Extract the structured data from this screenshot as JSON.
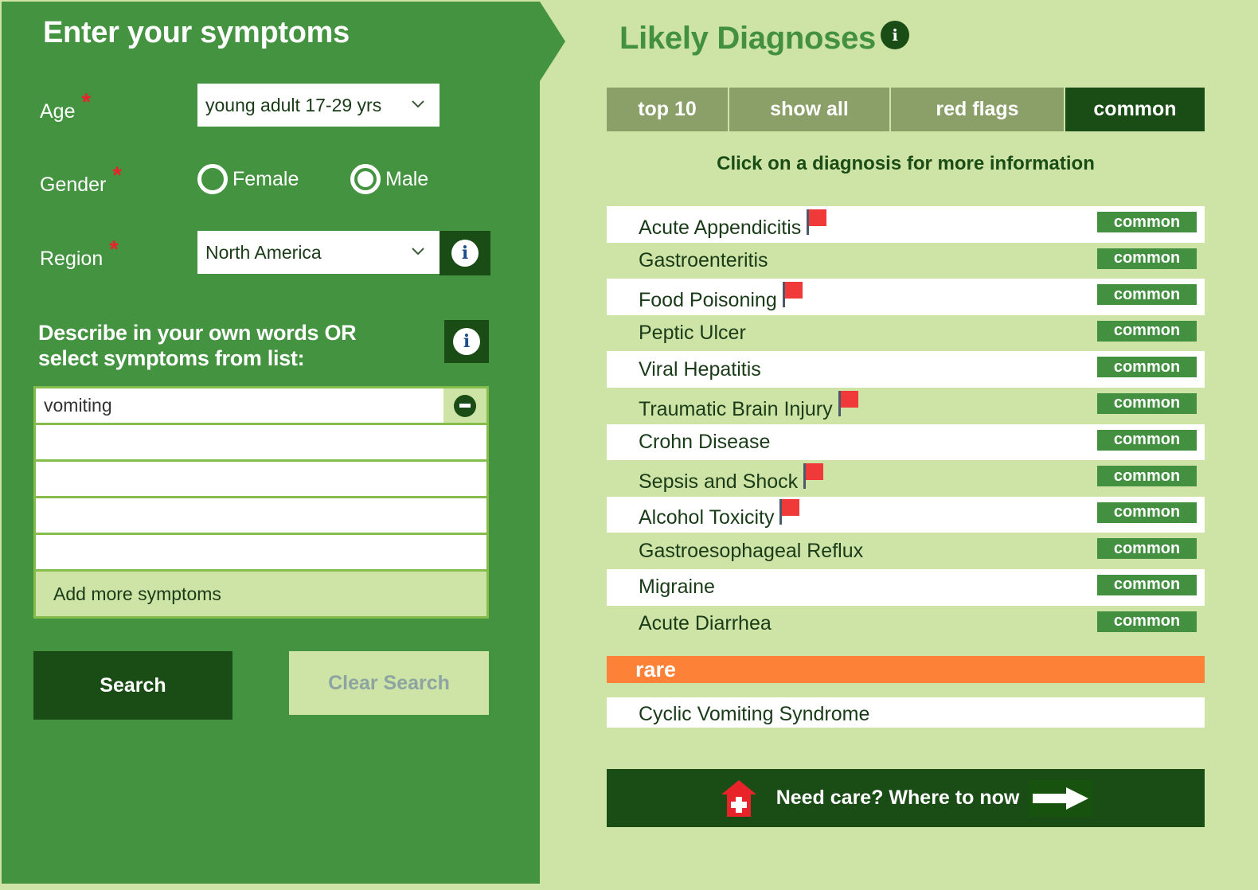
{
  "left": {
    "title": "Enter your symptoms",
    "age": {
      "label": "Age",
      "required_mark": "*",
      "value": "young adult 17-29 yrs"
    },
    "gender": {
      "label": "Gender",
      "required_mark": "*",
      "options": [
        {
          "label": "Female",
          "selected": false
        },
        {
          "label": "Male",
          "selected": true
        }
      ]
    },
    "region": {
      "label": "Region",
      "required_mark": "*",
      "value": "North America",
      "info_glyph": "i"
    },
    "describe": {
      "line1": "Describe in your own words OR",
      "line2": "select symptoms from list:",
      "info_glyph": "i"
    },
    "symptoms": [
      "vomiting",
      "",
      "",
      "",
      ""
    ],
    "add_more_label": "Add more symptoms",
    "search_label": "Search",
    "clear_label": "Clear Search"
  },
  "right": {
    "title": "Likely Diagnoses",
    "title_info_glyph": "i",
    "tabs": [
      {
        "label": "top 10",
        "active": false
      },
      {
        "label": "show all",
        "active": false
      },
      {
        "label": "red flags",
        "active": false
      },
      {
        "label": "common",
        "active": true
      }
    ],
    "hint": "Click on a diagnosis for more information",
    "diagnoses": [
      {
        "name": "Acute Appendicitis",
        "red_flag": true,
        "badge": "common"
      },
      {
        "name": "Gastroenteritis",
        "red_flag": false,
        "badge": "common"
      },
      {
        "name": "Food Poisoning",
        "red_flag": true,
        "badge": "common"
      },
      {
        "name": "Peptic Ulcer",
        "red_flag": false,
        "badge": "common"
      },
      {
        "name": "Viral Hepatitis",
        "red_flag": false,
        "badge": "common"
      },
      {
        "name": "Traumatic Brain Injury",
        "red_flag": true,
        "badge": "common"
      },
      {
        "name": "Crohn Disease",
        "red_flag": false,
        "badge": "common"
      },
      {
        "name": "Sepsis and Shock",
        "red_flag": true,
        "badge": "common"
      },
      {
        "name": "Alcohol Toxicity",
        "red_flag": true,
        "badge": "common"
      },
      {
        "name": "Gastroesophageal Reflux",
        "red_flag": false,
        "badge": "common"
      },
      {
        "name": "Migraine",
        "red_flag": false,
        "badge": "common"
      },
      {
        "name": "Acute Diarrhea",
        "red_flag": false,
        "badge": "common"
      }
    ],
    "rare_label": "rare",
    "rare_diagnoses": [
      {
        "name": "Cyclic Vomiting Syndrome"
      }
    ],
    "care_label": "Need care?  Where to now"
  },
  "colors": {
    "left_panel": "#449340",
    "right_panel": "#cee3a6",
    "dark_green": "#1a4c15",
    "tab_inactive": "#8aa068",
    "badge_green": "#439140",
    "rare_orange": "#fd8137",
    "required_red": "#e8242a",
    "flag_red": "#f03a3a"
  }
}
